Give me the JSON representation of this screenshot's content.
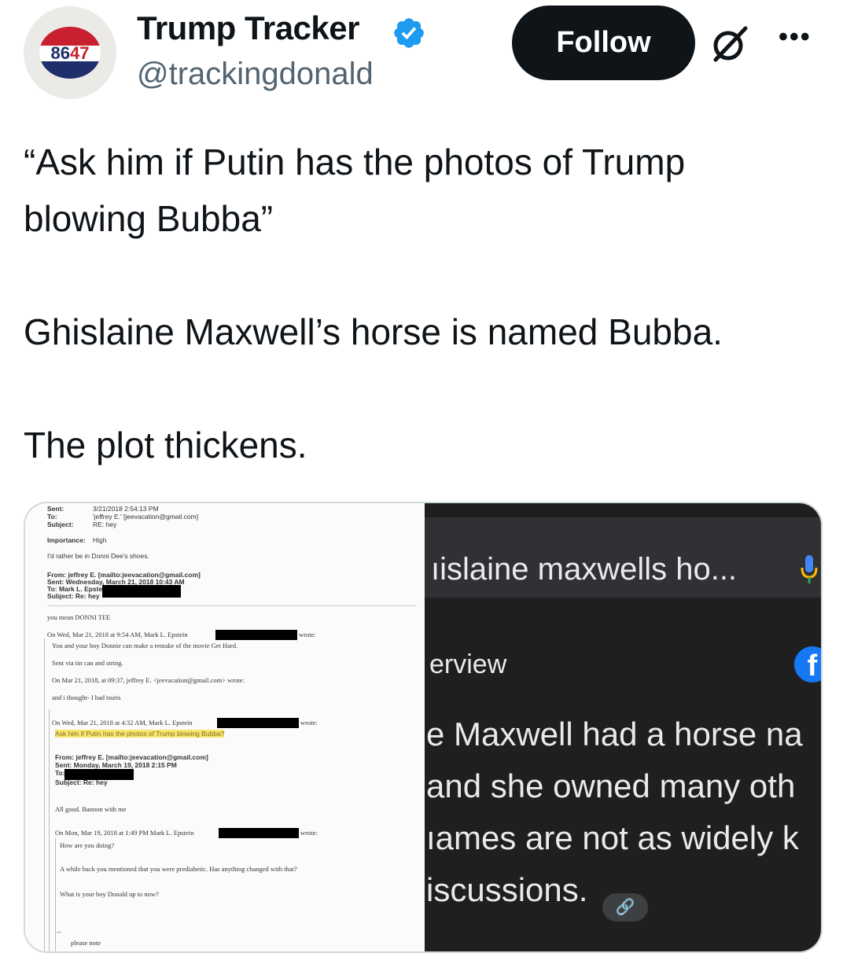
{
  "header": {
    "avatar_text_a": "86",
    "avatar_text_b": "47",
    "name": "Trump Tracker",
    "handle": "@trackingdonald",
    "follow_label": "Follow",
    "more_label": "•••"
  },
  "tweet": {
    "line1": "“Ask him if Putin has the photos of Trump",
    "line2": "blowing Bubba”",
    "line3": "Ghislaine Maxwell’s horse is named Bubba.",
    "line4": "The plot thickens."
  },
  "email": {
    "sent_label": "Sent:",
    "sent_value": "3/21/2018 2:54:13 PM",
    "to_label": "To:",
    "to_value": "'jeffrey E.' [jeevacation@gmail.com]",
    "subject_label": "Subject:",
    "subject_value": "RE: hey",
    "importance_label": "Importance:",
    "importance_value": "High",
    "l1": "I'd rather be in Donni Dee's shoes.",
    "l2": "From: jeffrey E. [mailto:jeevacation@gmail.com]",
    "l3": "Sent: Wednesday, March 21, 2018 10:43 AM",
    "l4": "To: Mark L. Epstein",
    "l5": "Subject: Re: hey",
    "l6": "you mean DONNI TEE",
    "l7": "On Wed, Mar 21, 2018 at 9:54 AM, Mark L. Epstein",
    "l7b": "wrote:",
    "l8": "You and your boy Donnie can make a remake of the movie Get Hard.",
    "l9": "Sent via tin can and string.",
    "l10": "On Mar 21, 2018, at 09:37, jeffrey E. <jeevacation@gmail.com> wrote:",
    "l11": "and i thought- I had tsuris",
    "l12": "On Wed, Mar 21, 2018 at 4:32 AM, Mark L. Epstein",
    "l12b": "wrote:",
    "l13": "Ask him if Putin has the photos of Trump blowing Bubba?",
    "l14": "From: jeffrey E. [mailto:jeevacation@gmail.com]",
    "l15": "Sent: Monday, March 19, 2018 2:15 PM",
    "l16": "To:",
    "l17": "Subject: Re: hey",
    "l18": "All good. Bannon with me",
    "l19": "On Mon, Mar 19, 2018 at 1:49 PM Mark L. Epstein",
    "l19b": "wrote:",
    "l20": "How are you doing?",
    "l21": "A while back you mentioned that you were prediabetic.  Has anything changed with that?",
    "l22": "What is your boy Donald up to now?",
    "l23": "--",
    "l24": "please note"
  },
  "search": {
    "query": "ıislaine maxwells ho...",
    "overview": "erview",
    "fb_letter": "f",
    "line1": "e Maxwell had a horse na",
    "line2": "and she owned many oth",
    "line3": "ıames are not as widely k",
    "line4": "iscussions.",
    "link_icon": "🔗"
  },
  "colors": {
    "follow_bg": "#0f1419",
    "verified": "#1d9bf0",
    "handle": "#536471",
    "search_bg": "#1f1f1f",
    "highlight": "#f5e76a"
  }
}
